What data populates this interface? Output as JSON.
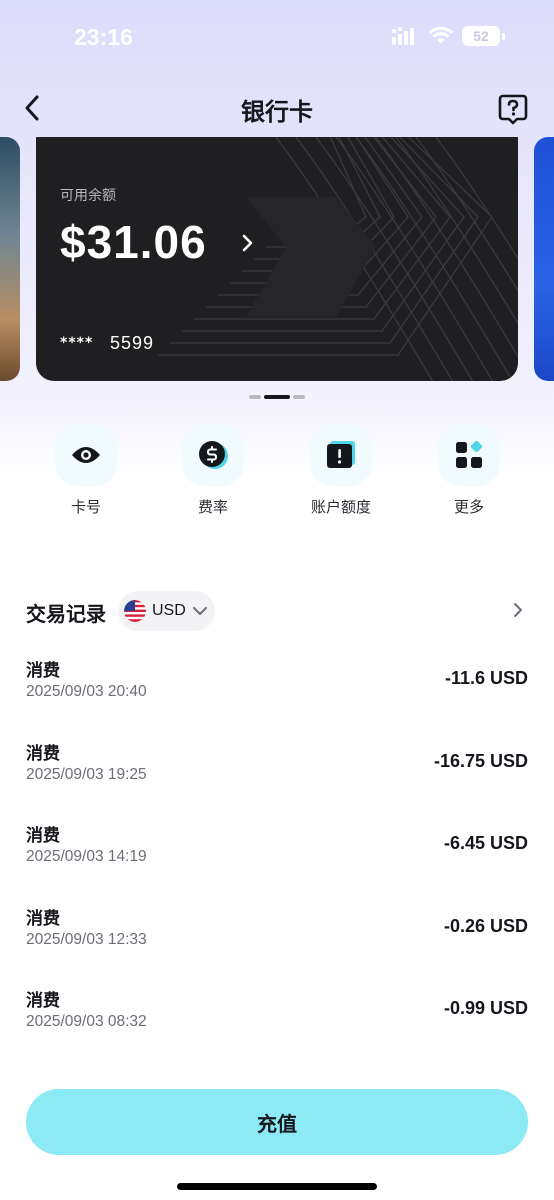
{
  "status_bar": {
    "time": "23:16",
    "battery": "52"
  },
  "nav": {
    "title": "银行卡"
  },
  "card": {
    "balance_label": "可用余额",
    "balance": "$31.06",
    "masked_number": "****",
    "last4": "5599"
  },
  "carousel": {
    "page_count": 3,
    "active_index": 1
  },
  "actions": [
    {
      "label": "卡号",
      "icon": "eye-icon"
    },
    {
      "label": "费率",
      "icon": "dollar-icon"
    },
    {
      "label": "账户额度",
      "icon": "alert-card-icon"
    },
    {
      "label": "更多",
      "icon": "grid-icon"
    }
  ],
  "transactions": {
    "title": "交易记录",
    "currency": "USD",
    "items": [
      {
        "type": "消费",
        "time": "2025/09/03 20:40",
        "amount": "-11.6 USD"
      },
      {
        "type": "消费",
        "time": "2025/09/03 19:25",
        "amount": "-16.75 USD"
      },
      {
        "type": "消费",
        "time": "2025/09/03 14:19",
        "amount": "-6.45 USD"
      },
      {
        "type": "消费",
        "time": "2025/09/03 12:33",
        "amount": "-0.26 USD"
      },
      {
        "type": "消费",
        "time": "2025/09/03 08:32",
        "amount": "-0.99 USD"
      }
    ]
  },
  "bottom": {
    "topup_label": "充值"
  },
  "colors": {
    "accent": "#8ceaf5",
    "card": "#1f1f21",
    "icon_teal": "#4fd5e6"
  }
}
